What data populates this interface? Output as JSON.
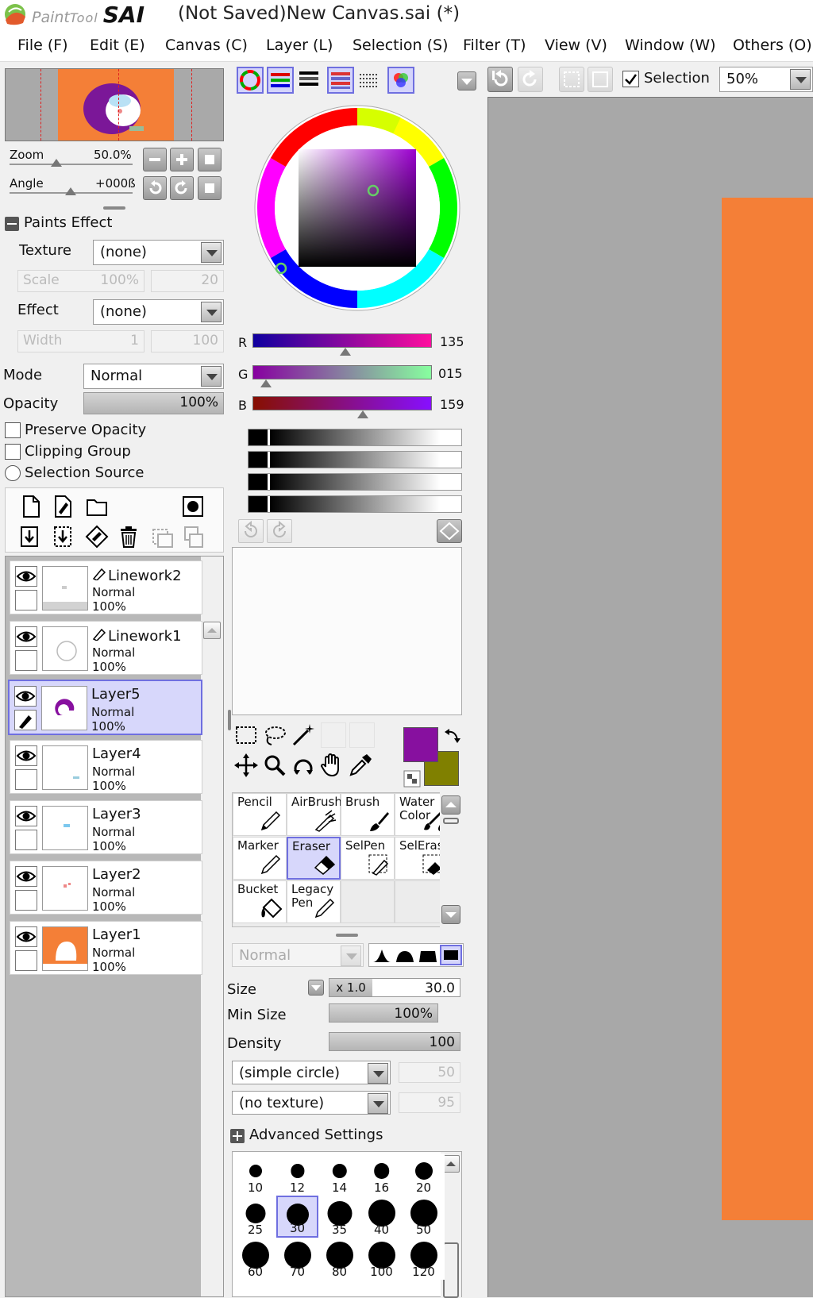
{
  "titlebar": {
    "logo_text": "PaintTool SAI",
    "title": "(Not Saved)New Canvas.sai (*)"
  },
  "menu": [
    {
      "label": "File (F)"
    },
    {
      "label": "Edit (E)"
    },
    {
      "label": "Canvas (C)"
    },
    {
      "label": "Layer (L)"
    },
    {
      "label": "Selection (S)"
    },
    {
      "label": "Filter (T)"
    },
    {
      "label": "View (V)"
    },
    {
      "label": "Window (W)"
    },
    {
      "label": "Others (O)"
    }
  ],
  "navigator": {
    "zoom_label": "Zoom",
    "zoom_value": "50.0%",
    "angle_label": "Angle",
    "angle_value": "+000ß"
  },
  "paints_effect": {
    "header": "Paints Effect",
    "texture_label": "Texture",
    "texture_value": "(none)",
    "scale_label": "Scale",
    "scale_value": "100%",
    "scale_strength": "20",
    "effect_label": "Effect",
    "effect_value": "(none)",
    "width_label": "Width",
    "width_value": "1",
    "width_strength": "100"
  },
  "layer_props": {
    "mode_label": "Mode",
    "mode_value": "Normal",
    "opacity_label": "Opacity",
    "opacity_value": "100%",
    "preserve_opacity": "Preserve Opacity",
    "clipping_group": "Clipping Group",
    "selection_source": "Selection Source"
  },
  "layers": [
    {
      "name": "Linework2",
      "mode": "Normal",
      "opacity": "100%",
      "selected": false
    },
    {
      "name": "Linework1",
      "mode": "Normal",
      "opacity": "100%",
      "selected": false
    },
    {
      "name": "Layer5",
      "mode": "Normal",
      "opacity": "100%",
      "selected": true
    },
    {
      "name": "Layer4",
      "mode": "Normal",
      "opacity": "100%",
      "selected": false
    },
    {
      "name": "Layer3",
      "mode": "Normal",
      "opacity": "100%",
      "selected": false
    },
    {
      "name": "Layer2",
      "mode": "Normal",
      "opacity": "100%",
      "selected": false
    },
    {
      "name": "Layer1",
      "mode": "Normal",
      "opacity": "100%",
      "selected": false
    }
  ],
  "color": {
    "r_label": "R",
    "r_value": "135",
    "g_label": "G",
    "g_value": "015",
    "b_label": "B",
    "b_value": "159",
    "primary": "#87109f",
    "secondary": "#808000"
  },
  "toolbar": {
    "selection_label": "Selection",
    "zoom_value": "50%"
  },
  "tools": [
    {
      "label": "Pencil"
    },
    {
      "label": "AirBrush"
    },
    {
      "label": "Brush"
    },
    {
      "label": "Water\nColor"
    },
    {
      "label": "Marker"
    },
    {
      "label": "Eraser"
    },
    {
      "label": "SelPen"
    },
    {
      "label": "SelEras"
    },
    {
      "label": "Bucket"
    },
    {
      "label": "Legacy\nPen"
    }
  ],
  "brush_settings": {
    "blend_mode": "Normal",
    "size_label": "Size",
    "size_multiplier": "x 1.0",
    "size_value": "30.0",
    "min_size_label": "Min Size",
    "min_size_value": "100%",
    "density_label": "Density",
    "density_value": "100",
    "shape_value": "(simple circle)",
    "shape_strength": "50",
    "texture_value": "(no texture)",
    "texture_strength": "95",
    "advanced_label": "Advanced Settings"
  },
  "brush_sizes": [
    "10",
    "12",
    "14",
    "16",
    "20",
    "25",
    "30",
    "35",
    "40",
    "50",
    "60",
    "70",
    "80",
    "100",
    "120"
  ],
  "canvas": {
    "background": "#a8a8a8",
    "paper_color": "#f47f37"
  }
}
